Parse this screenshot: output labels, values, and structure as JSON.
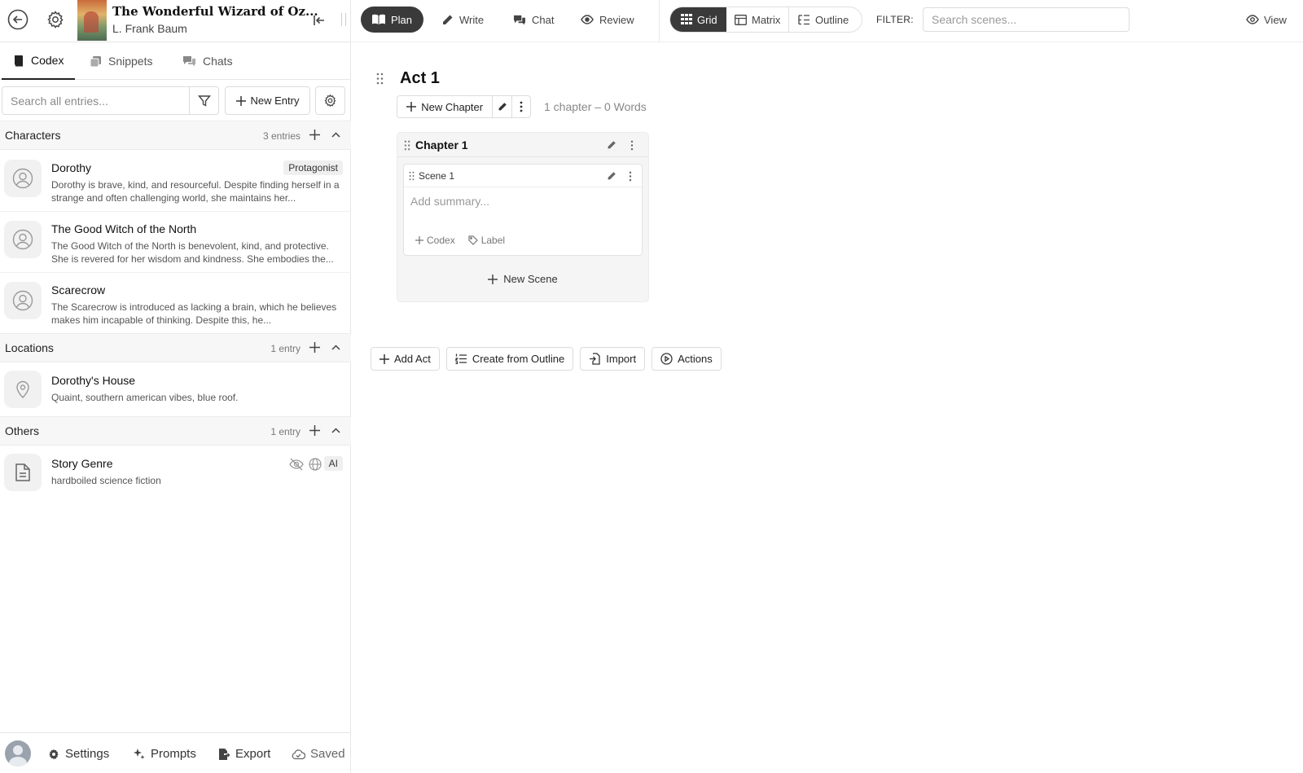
{
  "book": {
    "title": "The Wonderful Wizard of Oz...",
    "author": "L. Frank Baum"
  },
  "left_tabs": [
    {
      "label": "Codex",
      "icon": "book-icon"
    },
    {
      "label": "Snippets",
      "icon": "snippets-icon"
    },
    {
      "label": "Chats",
      "icon": "chats-icon"
    }
  ],
  "codex_search": {
    "placeholder": "Search all entries...",
    "new_entry_label": "New Entry"
  },
  "sections": {
    "characters": {
      "title": "Characters",
      "count": "3 entries",
      "entries": [
        {
          "name": "Dorothy",
          "badge": "Protagonist",
          "desc": "Dorothy is brave, kind, and resourceful. Despite finding herself in a strange and often challenging world, she maintains her..."
        },
        {
          "name": "The Good Witch of the North",
          "desc": "The Good Witch of the North is benevolent, kind, and protective. She is revered for her wisdom and kindness. She embodies the..."
        },
        {
          "name": "Scarecrow",
          "desc": "The Scarecrow is introduced as lacking a brain, which he believes makes him incapable of thinking. Despite this, he..."
        }
      ]
    },
    "locations": {
      "title": "Locations",
      "count": "1 entry",
      "entries": [
        {
          "name": "Dorothy's House",
          "desc": "Quaint, southern american vibes, blue roof."
        }
      ]
    },
    "others": {
      "title": "Others",
      "count": "1 entry",
      "entries": [
        {
          "name": "Story Genre",
          "badge": "AI",
          "desc": "hardboiled science fiction"
        }
      ]
    }
  },
  "footer": {
    "settings": "Settings",
    "prompts": "Prompts",
    "export": "Export",
    "saved": "Saved"
  },
  "modes": [
    {
      "label": "Plan",
      "active": true
    },
    {
      "label": "Write"
    },
    {
      "label": "Chat"
    },
    {
      "label": "Review"
    }
  ],
  "views": [
    {
      "label": "Grid",
      "active": true
    },
    {
      "label": "Matrix"
    },
    {
      "label": "Outline"
    }
  ],
  "filter": {
    "label": "FILTER:",
    "placeholder": "Search scenes..."
  },
  "view_toggle": "View",
  "act": {
    "title": "Act 1",
    "new_chapter_label": "New Chapter",
    "meta": "1 chapter  –  0 Words",
    "chapter": {
      "title": "Chapter 1",
      "scene": {
        "title": "Scene 1",
        "summary_placeholder": "Add summary...",
        "codex_label": "Codex",
        "label_label": "Label"
      },
      "new_scene_label": "New Scene"
    }
  },
  "bottom_actions": {
    "add_act": "Add Act",
    "create_from_outline": "Create from Outline",
    "import": "Import",
    "actions": "Actions"
  }
}
